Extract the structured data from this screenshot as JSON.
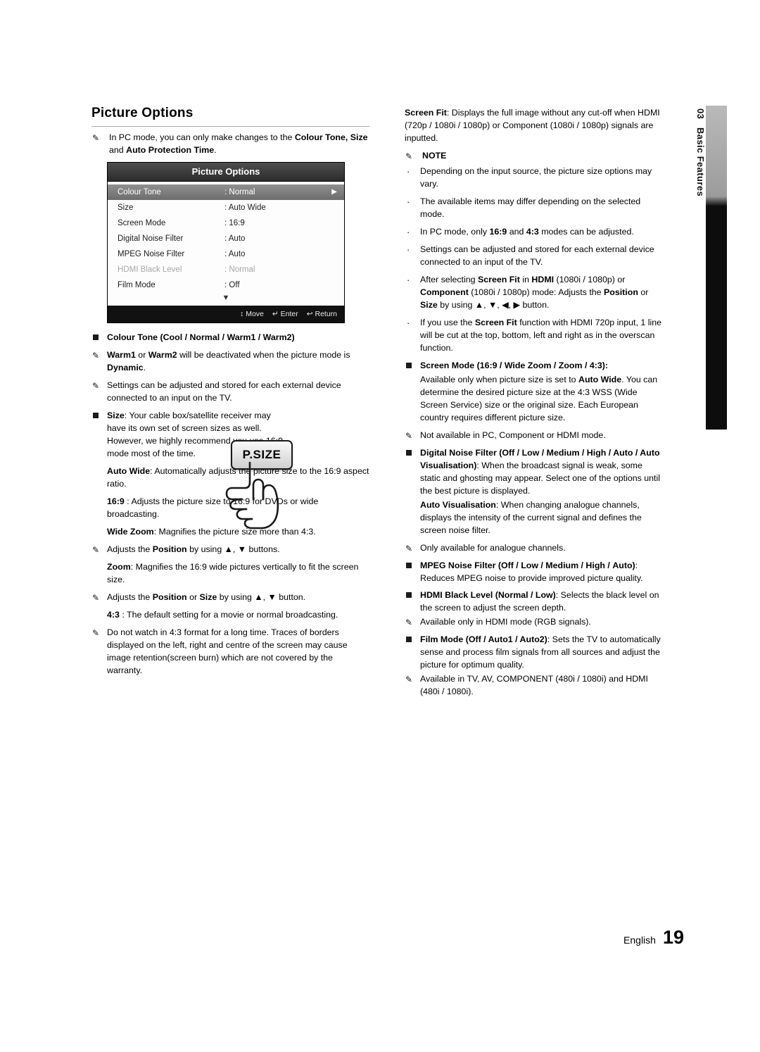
{
  "document": {
    "title": "Picture Options",
    "footer": {
      "language": "English",
      "page_number": "19"
    },
    "side_tab": {
      "chapter_number": "03",
      "chapter_label": "Basic Features"
    }
  },
  "left": {
    "intro_note": {
      "glyph": "note-icon",
      "text_1": "In PC mode, you can only make changes to the ",
      "bold_1": "Colour Tone, Size",
      "text_2": " and ",
      "bold_2": "Auto Protection Time",
      "text_3": "."
    },
    "osd": {
      "header": "Picture Options",
      "rows": [
        {
          "key": "Colour Tone",
          "value": ": Normal",
          "selected": true,
          "arrow": "▶"
        },
        {
          "key": "Size",
          "value": ": Auto Wide",
          "selected": false,
          "arrow": ""
        },
        {
          "key": "Screen Mode",
          "value": ": 16:9",
          "selected": false,
          "arrow": ""
        },
        {
          "key": "Digital Noise Filter",
          "value": ": Auto",
          "selected": false,
          "arrow": ""
        },
        {
          "key": "MPEG Noise Filter",
          "value": ": Auto",
          "selected": false,
          "arrow": ""
        },
        {
          "key": "HDMI Black Level",
          "value": ": Normal",
          "selected": false,
          "dim": true,
          "arrow": ""
        },
        {
          "key": "Film Mode",
          "value": ": Off",
          "selected": false,
          "arrow": ""
        }
      ],
      "scroll_down": "▼",
      "footer": {
        "move": "Move",
        "move_icon": "↕",
        "enter": "Enter",
        "enter_icon": "↵",
        "return": "Return",
        "return_icon": "↩"
      }
    },
    "colour_tone": {
      "heading": "Colour Tone (Cool / Normal / Warm1 / Warm2)",
      "note_1": {
        "bold_1": "Warm1",
        "mid": " or ",
        "bold_2": "Warm2",
        "text": " will be deactivated when the picture mode is ",
        "bold_3": "Dynamic",
        "tail": "."
      },
      "note_2": "Settings can be adjusted and stored for each external device connected to an input on the TV."
    },
    "size": {
      "heading_bold": "Size",
      "heading_rest": ": Your cable box/satellite receiver may have its own set of screen sizes as well. However, we highly recommend you use 16:9 mode most of the time.",
      "auto_wide_bold": "Auto Wide",
      "auto_wide_rest": ": Automatically adjusts the picture size to the 16:9 aspect ratio.",
      "r169_bold": "16:9",
      "r169_rest": " : Adjusts the picture size to 16:9 for DVDs or wide broadcasting.",
      "wide_zoom_bold": "Wide Zoom",
      "wide_zoom_rest": ": Magnifies the picture size more than 4:3.",
      "wide_zoom_note_pre": "Adjusts the ",
      "wide_zoom_note_bold": "Position",
      "wide_zoom_note_post": " by using ▲, ▼ buttons.",
      "zoom_bold": "Zoom",
      "zoom_rest": ": Magnifies the 16:9 wide pictures vertically to fit the screen size.",
      "zoom_note_pre": "Adjusts the ",
      "zoom_note_bold_1": "Position",
      "zoom_note_mid": " or ",
      "zoom_note_bold_2": "Size",
      "zoom_note_post": " by using ▲, ▼ button.",
      "r43_bold": "4:3",
      "r43_rest": " : The default setting for a movie or normal broadcasting.",
      "r43_note": "Do not watch in 4:3 format for a long time. Traces of borders displayed on the left, right and centre of the screen may cause image retention(screen burn) which are not covered by the warranty."
    },
    "psize_button_label": "P.SIZE"
  },
  "right": {
    "screen_fit": {
      "bold": "Screen Fit",
      "rest": ": Displays the full image without any cut-off when HDMI (720p / 1080i / 1080p) or Component (1080i / 1080p) signals are inputted."
    },
    "note_heading": "NOTE",
    "notes": [
      {
        "parts": [
          {
            "t": "Depending on the input source, the picture size options may vary."
          }
        ]
      },
      {
        "parts": [
          {
            "t": "The available items may differ depending on the selected mode."
          }
        ]
      },
      {
        "parts": [
          {
            "t": "In PC mode, only "
          },
          {
            "t": "16:9",
            "b": true
          },
          {
            "t": " and "
          },
          {
            "t": "4:3",
            "b": true
          },
          {
            "t": " modes can be adjusted."
          }
        ]
      },
      {
        "parts": [
          {
            "t": "Settings can be adjusted and stored for each external device connected to an input of the TV."
          }
        ]
      },
      {
        "parts": [
          {
            "t": "After selecting "
          },
          {
            "t": "Screen Fit",
            "b": true
          },
          {
            "t": " in "
          },
          {
            "t": "HDMI",
            "b": true
          },
          {
            "t": " (1080i / 1080p) or "
          },
          {
            "t": "Component",
            "b": true
          },
          {
            "t": " (1080i / 1080p) mode: Adjusts the "
          },
          {
            "t": "Position",
            "b": true
          },
          {
            "t": " or "
          },
          {
            "t": "Size",
            "b": true
          },
          {
            "t": " by using ▲, ▼, ◀, ▶ button."
          }
        ]
      },
      {
        "parts": [
          {
            "t": "If you use the "
          },
          {
            "t": "Screen Fit",
            "b": true
          },
          {
            "t": " function with HDMI 720p input, 1 line will be cut at the top, bottom, left and right as in the overscan function."
          }
        ]
      }
    ],
    "screen_mode": {
      "heading_bold": "Screen Mode (16:9 / Wide Zoom / Zoom / 4:3)",
      "heading_rest": ":",
      "body_pre": "Available only when picture size is set to ",
      "body_bold": "Auto Wide",
      "body_post": ". You can determine the desired picture size at the 4:3 WSS (Wide Screen Service) size or the original size. Each European country requires different picture size.",
      "note": "Not available in PC, Component or HDMI mode."
    },
    "digital_noise_filter": {
      "heading_bold_1": "Digital Noise Filter (Off / Low / Medium / High / Auto",
      "heading_rest_1": " ",
      "heading_bold_2": "/ Auto Visualisation)",
      "heading_rest_2": ": When the broadcast signal is weak, some static and ghosting may appear. Select one of the options until the best picture is displayed.",
      "body_bold": "Auto Visualisation",
      "body_rest": ": When changing analogue channels, displays the intensity of the current signal and defines the screen noise filter.",
      "note": "Only available for analogue channels."
    },
    "mpeg_noise_filter": {
      "heading_bold_1": "MPEG Noise Filter (Off / Low / Medium / High /",
      "heading_bold_2": "Auto)",
      "heading_rest": ": Reduces MPEG noise to provide improved picture quality."
    },
    "hdmi_black_level": {
      "heading_bold": "HDMI Black Level (Normal / Low)",
      "heading_rest": ": Selects the black level on the screen to adjust the screen depth.",
      "note": "Available only in HDMI mode (RGB signals)."
    },
    "film_mode": {
      "heading_bold": "Film Mode (Off / Auto1 / Auto2)",
      "heading_rest": ": Sets the TV to automatically sense and process film signals from all sources and adjust the picture for optimum quality.",
      "note": "Available in TV, AV, COMPONENT (480i / 1080i) and HDMI (480i / 1080i)."
    }
  }
}
